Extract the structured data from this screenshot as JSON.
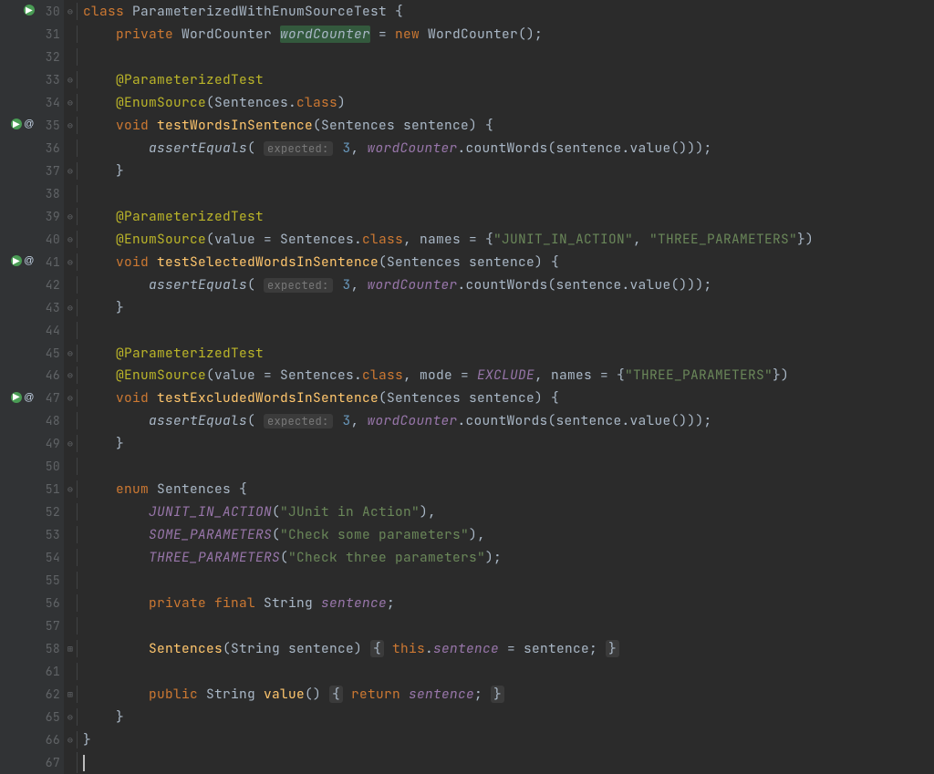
{
  "colors": {
    "keyword": "#CC7832",
    "annotation": "#BBB529",
    "method": "#FFC66D",
    "string": "#6A8759",
    "number": "#6897BB",
    "field": "#9876AA",
    "hint_bg": "#3B3B3B",
    "gutter_bg": "#313335",
    "bg": "#2B2B2B"
  },
  "tokens": {
    "class": "class",
    "private": "private",
    "final": "final",
    "public": "public",
    "enum": "enum",
    "void": "void",
    "new": "new",
    "return": "return",
    "this": "this",
    "ParamTest": "@ParameterizedTest",
    "EnumSource": "@EnumSource",
    "classType": "ParameterizedWithEnumSourceTest",
    "WordCounter": "WordCounter",
    "wordCounter": "wordCounter",
    "Sentences": "Sentences",
    "class_kw": "class",
    "value_eq": "value = ",
    "mode_eq": "mode = ",
    "names_eq": "names = ",
    "EXCLUDE": "EXCLUDE",
    "test1": "testWordsInSentence",
    "test2": "testSelectedWordsInSentence",
    "test3": "testExcludedWordsInSentence",
    "sentence": "sentence",
    "assertEquals": "assertEquals",
    "expected": "expected:",
    "three": "3",
    "countWords": "countWords",
    "value": "value",
    "JUnitInAction": "\"JUnit in Action\"",
    "CheckSome": "\"Check some parameters\"",
    "CheckThree": "\"Check three parameters\"",
    "JUNIT_IN_ACTION": "JUNIT_IN_ACTION",
    "SOME_PARAMETERS": "SOME_PARAMETERS",
    "THREE_PARAMETERS": "THREE_PARAMETERS",
    "String": "String",
    "SentencesCtor": "Sentences",
    "str_JUNIT": "\"JUNIT_IN_ACTION\"",
    "str_THREE": "\"THREE_PARAMETERS\""
  },
  "gutter_icons": {
    "run_arrow": "▶",
    "recursive": "↻",
    "override": "@"
  },
  "line_numbers": [
    "30",
    "31",
    "32",
    "33",
    "34",
    "35",
    "36",
    "37",
    "38",
    "39",
    "40",
    "41",
    "42",
    "43",
    "44",
    "45",
    "46",
    "47",
    "48",
    "49",
    "50",
    "51",
    "52",
    "53",
    "54",
    "55",
    "56",
    "57",
    "58",
    "61",
    "62",
    "65",
    "66",
    "67"
  ]
}
